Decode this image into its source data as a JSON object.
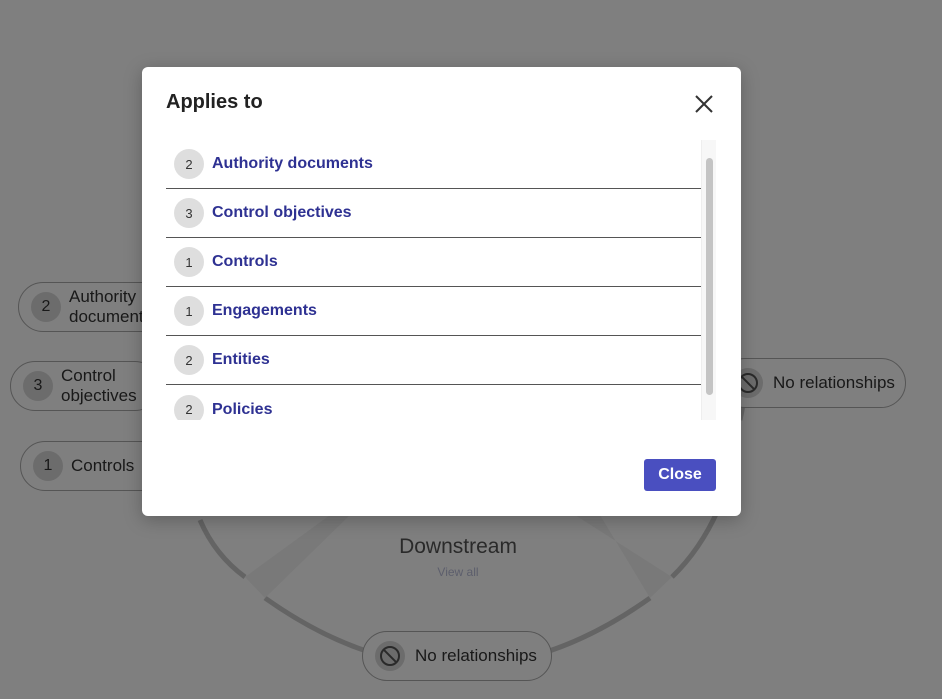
{
  "background": {
    "left_pills": [
      {
        "count": "2",
        "label": "Authority documents"
      },
      {
        "count": "3",
        "label": "Control objectives"
      },
      {
        "count": "1",
        "label": "Controls"
      }
    ],
    "right_pill": {
      "label": "No relationships",
      "icon": "no-entry-icon"
    },
    "bottom_pill": {
      "label": "No relationships",
      "icon": "no-entry-icon"
    },
    "downstream": {
      "title": "Downstream",
      "link": "View all"
    }
  },
  "modal": {
    "title": "Applies to",
    "close_icon": "close-icon",
    "items": [
      {
        "count": "2",
        "label": "Authority documents"
      },
      {
        "count": "3",
        "label": "Control objectives"
      },
      {
        "count": "1",
        "label": "Controls"
      },
      {
        "count": "1",
        "label": "Engagements"
      },
      {
        "count": "2",
        "label": "Entities"
      },
      {
        "count": "2",
        "label": "Policies"
      }
    ],
    "close_button_label": "Close"
  },
  "colors": {
    "accent": "#4a4fc0",
    "link": "#2e3192",
    "overlay": "rgba(0,0,0,0.5)"
  }
}
